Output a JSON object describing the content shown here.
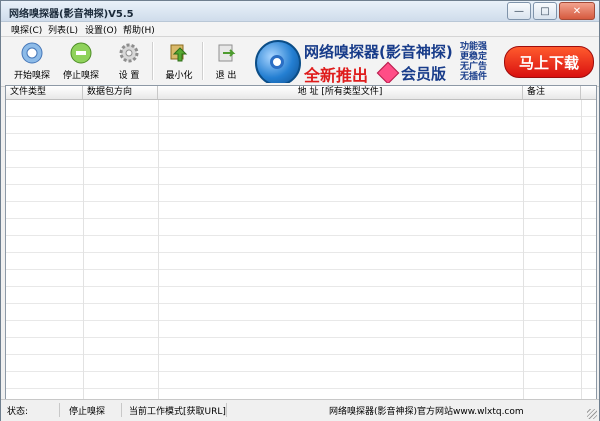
{
  "window": {
    "title": "网络嗅探器(影音神探)V5.5"
  },
  "titlebar_buttons": {
    "minimize": "—",
    "maximize": "□",
    "close": "✕"
  },
  "menu": [
    "嗅探(C)",
    "列表(L)",
    "设置(O)",
    "帮助(H)"
  ],
  "toolbar": {
    "start": "开始嗅探",
    "stop": "停止嗅探",
    "settings": "设 置",
    "minimize": "最小化",
    "exit": "退 出"
  },
  "banner": {
    "title": "网络嗅探器(影音神探)",
    "subtitle": "全新推出",
    "member": "会员版",
    "features": [
      "功能强",
      "更稳定",
      "无广告",
      "无插件"
    ],
    "download": "马上下载"
  },
  "table": {
    "columns": [
      "文件类型",
      "数据包方向",
      "地    址 [所有类型文件]",
      "备注"
    ],
    "rows": []
  },
  "status": {
    "label": "状态:",
    "state": "停止嗅探",
    "mode": "当前工作模式[获取URL]",
    "site": "网络嗅探器(影音神探)官方网站www.wlxtq.com"
  }
}
